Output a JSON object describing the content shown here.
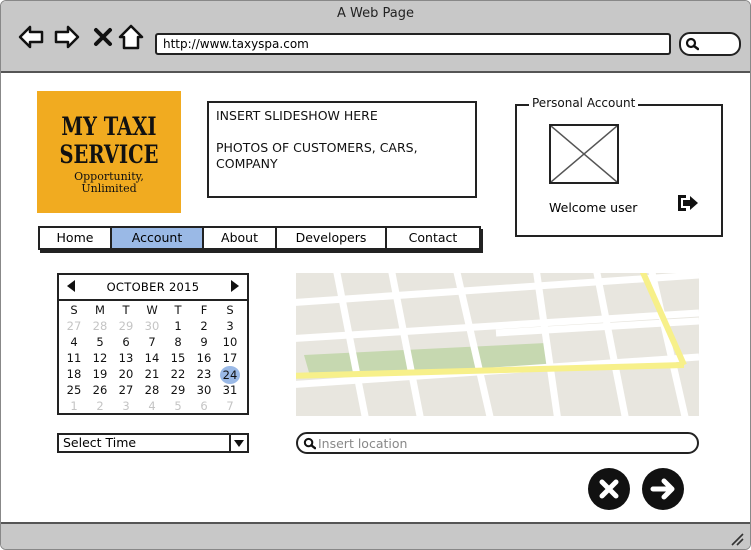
{
  "browser": {
    "title": "A Web Page",
    "url": "http://www.taxyspa.com"
  },
  "logo": {
    "line1": "MY TAXI",
    "line2": "SERVICE",
    "tagline1": "Opportunity,",
    "tagline2": "Unlimited"
  },
  "slideshow": {
    "line1": "INSERT SLIDESHOW HERE",
    "line2": "PHOTOS OF CUSTOMERS, CARS, COMPANY"
  },
  "account": {
    "legend": "Personal Account",
    "welcome": "Welcome user"
  },
  "menu": {
    "items": [
      {
        "label": "Home"
      },
      {
        "label": "Account"
      },
      {
        "label": "About"
      },
      {
        "label": "Developers"
      },
      {
        "label": "Contact"
      }
    ],
    "active": "Account"
  },
  "calendar": {
    "month": "OCTOBER 2015",
    "weekdays": [
      "S",
      "M",
      "T",
      "W",
      "T",
      "F",
      "S"
    ],
    "weeks": [
      [
        "27",
        "28",
        "29",
        "30",
        "1",
        "2",
        "3"
      ],
      [
        "4",
        "5",
        "6",
        "7",
        "8",
        "9",
        "10"
      ],
      [
        "11",
        "12",
        "13",
        "14",
        "15",
        "16",
        "17"
      ],
      [
        "18",
        "19",
        "20",
        "21",
        "22",
        "23",
        "24"
      ],
      [
        "25",
        "26",
        "27",
        "28",
        "29",
        "30",
        "31"
      ],
      [
        "1",
        "2",
        "3",
        "4",
        "5",
        "6",
        "7"
      ]
    ],
    "selected": "24"
  },
  "time_select": {
    "value": "Select Time"
  },
  "location_search": {
    "placeholder": "Insert location"
  },
  "colors": {
    "logo_bg": "#f1ab20",
    "chrome": "#c8c8c8",
    "highlight": "#9ab9e6",
    "map_bg": "#e8e6df",
    "map_park": "#c6d8b0",
    "map_road_major": "#f7f08a"
  },
  "icons": {
    "back": "arrow-left-icon",
    "forward": "arrow-right-icon",
    "stop": "close-icon",
    "home": "home-icon",
    "search": "search-icon",
    "logout": "logout-icon",
    "avatar": "image-placeholder-icon",
    "cancel": "cancel-icon",
    "submit": "arrow-circle-right-icon"
  }
}
